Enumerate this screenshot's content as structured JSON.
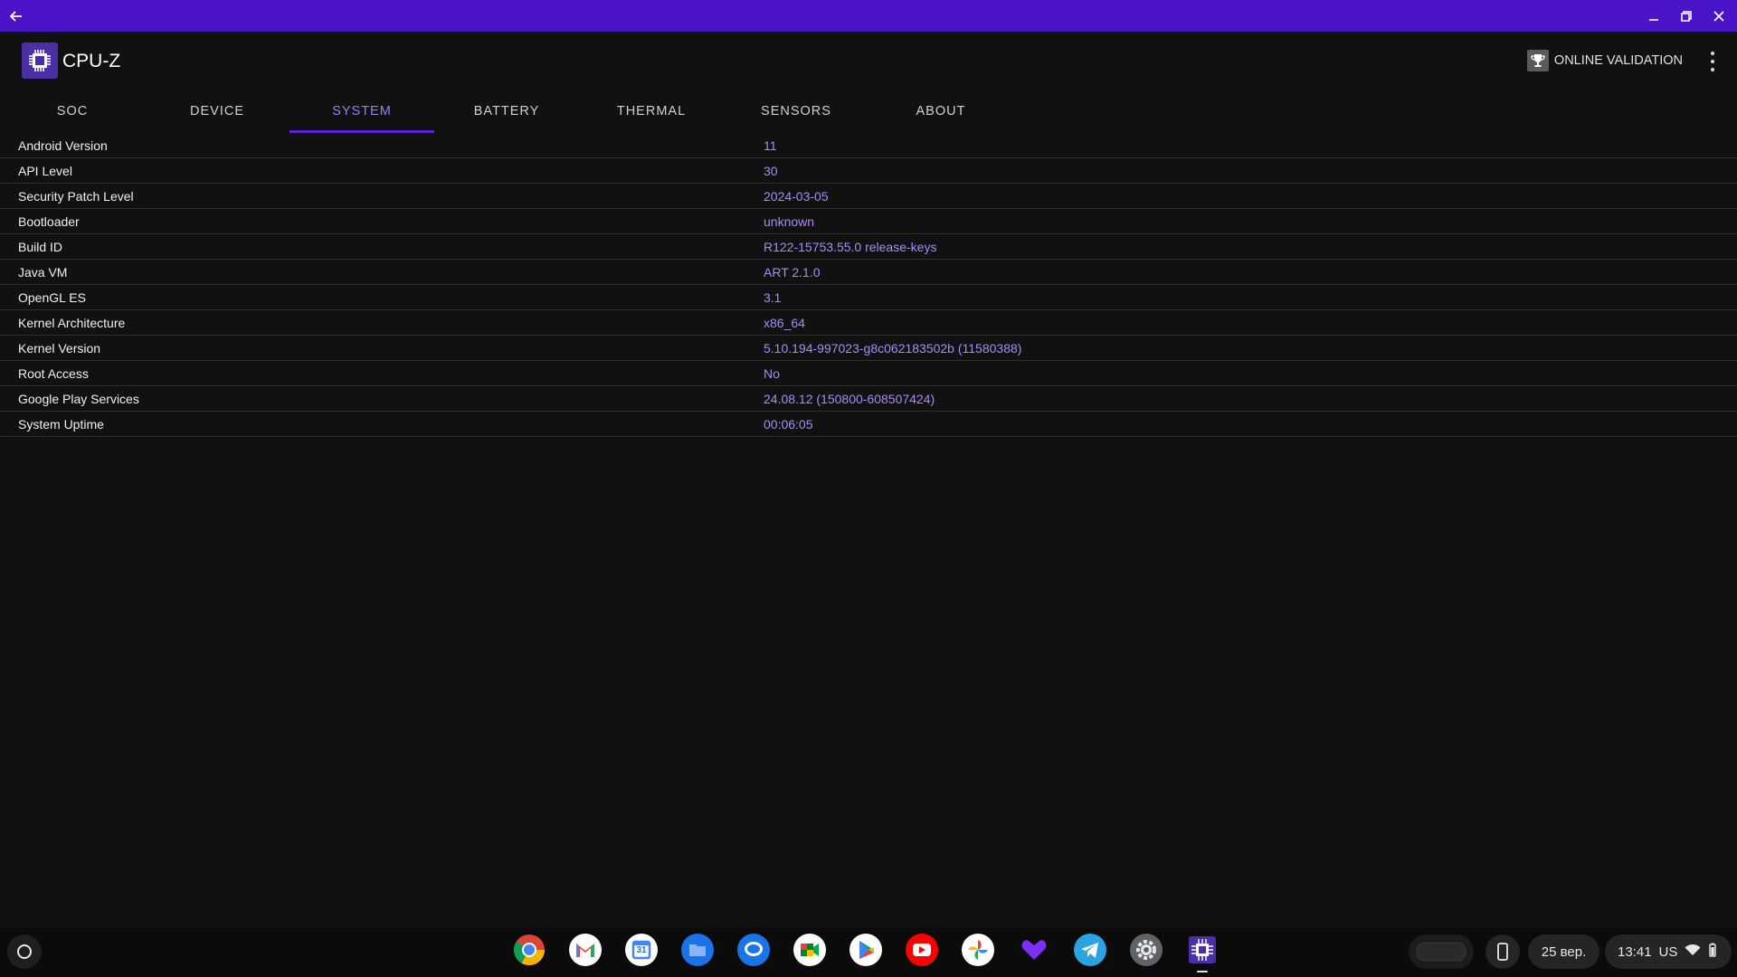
{
  "app": {
    "title": "CPU-Z"
  },
  "header": {
    "validation_label": "ONLINE VALIDATION"
  },
  "tabs": [
    {
      "label": "SOC"
    },
    {
      "label": "DEVICE"
    },
    {
      "label": "SYSTEM"
    },
    {
      "label": "BATTERY"
    },
    {
      "label": "THERMAL"
    },
    {
      "label": "SENSORS"
    },
    {
      "label": "ABOUT"
    }
  ],
  "active_tab": "SYSTEM",
  "rows": [
    {
      "key": "Android Version",
      "value": "11"
    },
    {
      "key": "API Level",
      "value": "30"
    },
    {
      "key": "Security Patch Level",
      "value": "2024-03-05"
    },
    {
      "key": "Bootloader",
      "value": "unknown"
    },
    {
      "key": "Build ID",
      "value": "R122-15753.55.0 release-keys"
    },
    {
      "key": "Java VM",
      "value": "ART 2.1.0"
    },
    {
      "key": "OpenGL ES",
      "value": "3.1"
    },
    {
      "key": "Kernel Architecture",
      "value": "x86_64"
    },
    {
      "key": "Kernel Version",
      "value": "5.10.194-997023-g8c062183502b (11580388)"
    },
    {
      "key": "Root Access",
      "value": "No"
    },
    {
      "key": "Google Play Services",
      "value": "24.08.12 (150800-608507424)"
    },
    {
      "key": "System Uptime",
      "value": "00:06:05"
    }
  ],
  "shelf": {
    "apps": [
      "chrome-icon",
      "gmail-icon",
      "calendar-icon",
      "files-icon",
      "messages-icon",
      "meet-icon",
      "play-store-icon",
      "youtube-icon",
      "photos-icon",
      "heart-app-icon",
      "telegram-icon",
      "settings-icon",
      "cpu-z-icon"
    ],
    "calendar_day": "31",
    "date": "25 вер.",
    "time": "13:41",
    "ime": "US"
  },
  "colors": {
    "titlebar": "#4a14c8",
    "accent": "#9b7cf6",
    "value_text": "#a78bfa",
    "background": "#111111"
  }
}
